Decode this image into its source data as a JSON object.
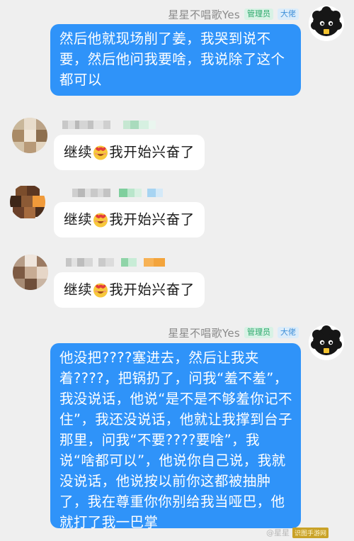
{
  "colors": {
    "background": "#efefef",
    "bubble_self": "#2f93f9",
    "bubble_other": "#ffffff",
    "badge_admin": "#2aa86a",
    "badge_boss": "#3f8fd8"
  },
  "messages": [
    {
      "sender": "星星不唱歌Yes",
      "badge_admin": "管理员",
      "badge_boss": "大佬",
      "text": "然后他就现场削了姜，我哭到说不要，然后他问我要啥，我说除了这个都可以"
    },
    {
      "reply_prefix": "继续",
      "reply_suffix": "我开始兴奋了",
      "emoji": "heart-eyes-face"
    },
    {
      "reply_prefix": "继续",
      "reply_suffix": "我开始兴奋了",
      "emoji": "heart-eyes-face"
    },
    {
      "reply_prefix": "继续",
      "reply_suffix": "我开始兴奋了",
      "emoji": "heart-eyes-face"
    },
    {
      "sender": "星星不唱歌Yes",
      "badge_admin": "管理员",
      "badge_boss": "大佬",
      "text": "他没把????塞进去，然后让我夹着????，把锅扔了，问我“羞不羞”，我没说话，他说“是不是不够羞你记不住”，我还没说话，他就让我撑到台子那里，问我“不要????要啥”，我说“啥都可以”，他说你自己说，我就没说话，他说按以前你这都被抽肿了，我在尊重你你别给我当哑巴，他就打了我一巴掌"
    }
  ],
  "watermark": {
    "text": "@星星",
    "logo": "识图手游网"
  }
}
